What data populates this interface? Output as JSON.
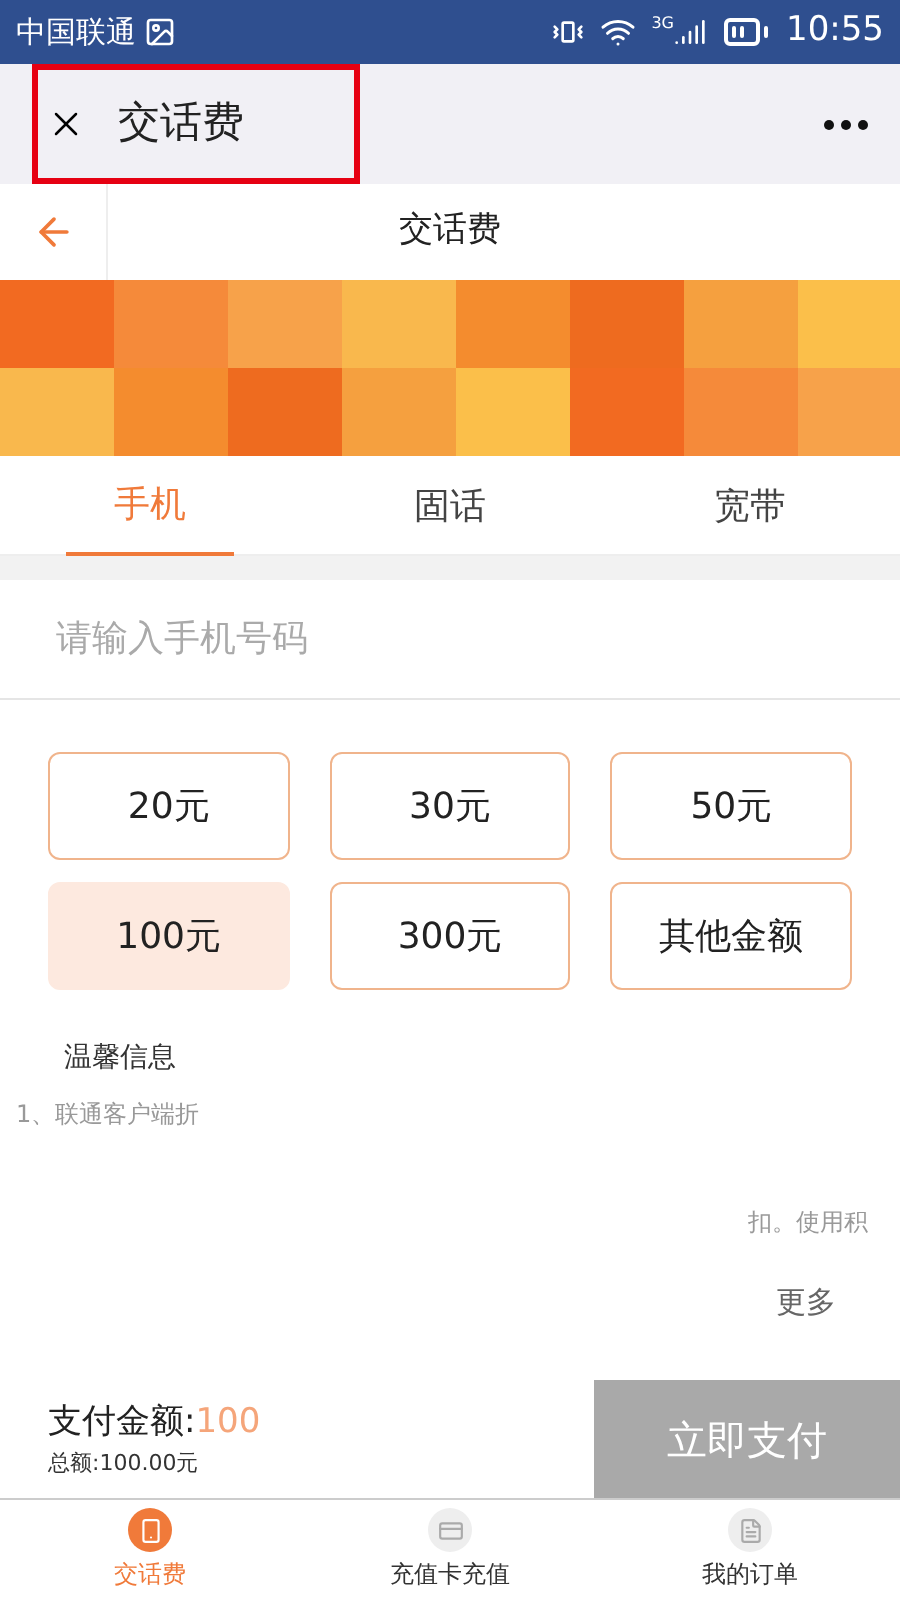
{
  "status_bar": {
    "carrier": "中国联通",
    "network": "3G",
    "time": "10:55"
  },
  "top_bar": {
    "title": "交话费",
    "highlighted": true
  },
  "header": {
    "title": "交话费"
  },
  "tabs": [
    {
      "label": "手机",
      "selected": true
    },
    {
      "label": "固话",
      "selected": false
    },
    {
      "label": "宽带",
      "selected": false
    }
  ],
  "phone_field": {
    "placeholder": "请输入手机号码"
  },
  "amounts": [
    {
      "label": "20元",
      "selected": false
    },
    {
      "label": "30元",
      "selected": false
    },
    {
      "label": "50元",
      "selected": false
    },
    {
      "label": "100元",
      "selected": true
    },
    {
      "label": "300元",
      "selected": false
    },
    {
      "label": "其他金额",
      "selected": false
    }
  ],
  "tips": {
    "title": "温馨信息",
    "line_1": "1、联通客户端折",
    "line_2": "扣。使用积",
    "more": "更多"
  },
  "payment": {
    "label": "支付金额:",
    "amount": "100",
    "total": "总额:100.00元",
    "button": "立即支付",
    "disabled": true
  },
  "nav": [
    {
      "label": "交话费",
      "selected": true
    },
    {
      "label": "充值卡充值",
      "selected": false
    },
    {
      "label": "我的订单",
      "selected": false
    }
  ]
}
